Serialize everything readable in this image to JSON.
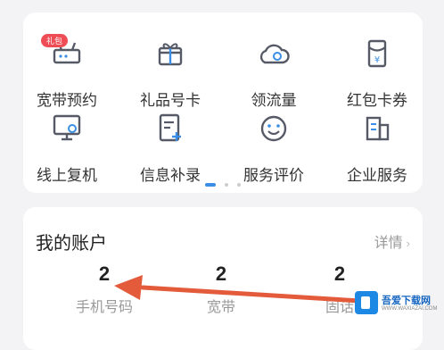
{
  "services": {
    "badge": "礼包",
    "items": [
      {
        "label": "宽带预约",
        "icon": "router-icon"
      },
      {
        "label": "礼品号卡",
        "icon": "gift-icon"
      },
      {
        "label": "领流量",
        "icon": "cloud-data-icon"
      },
      {
        "label": "红包卡券",
        "icon": "red-packet-icon"
      },
      {
        "label": "线上复机",
        "icon": "monitor-icon"
      },
      {
        "label": "信息补录",
        "icon": "document-edit-icon"
      },
      {
        "label": "服务评价",
        "icon": "smile-icon"
      },
      {
        "label": "企业服务",
        "icon": "building-icon"
      }
    ],
    "pager": {
      "pages": 3,
      "active": 1
    }
  },
  "account": {
    "title": "我的账户",
    "detail": "详情",
    "stats": [
      {
        "value": "2",
        "label": "手机号码"
      },
      {
        "value": "2",
        "label": "宽带"
      },
      {
        "value": "2",
        "label": "固话"
      }
    ]
  },
  "colors": {
    "accent": "#3a8ee6",
    "arrow": "#e45b3c",
    "icon": "#555a66"
  },
  "watermark": {
    "brand": "吾爱下载网",
    "site": "WWW.WAXIAZAI.COM"
  }
}
